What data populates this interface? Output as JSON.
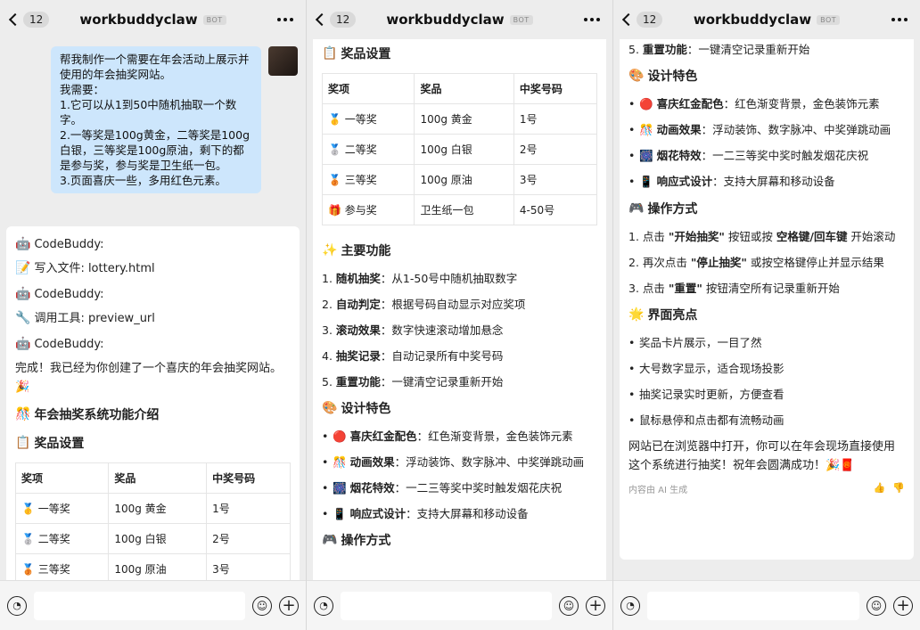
{
  "header": {
    "badge": "12",
    "title": "workbuddyclaw",
    "bot_tag": "BOT"
  },
  "icons": {
    "back": "chevron-left-icon",
    "more": "more-dots-icon",
    "voice": "voice-icon",
    "emoji": "smile-icon",
    "plus": "plus-icon"
  },
  "user_message": [
    "帮我制作一个需要在年会活动上展示并使用的年会抽奖网站。",
    "我需要：",
    "1.它可以从1到50中随机抽取一个数字。",
    "2.一等奖是100g黄金，二等奖是100g白银，三等奖是100g原油，剩下的都是参与奖，参与奖是卫生纸一包。",
    "3.页面喜庆一些，多用红色元素。"
  ],
  "bot_log": [
    {
      "agent": "CodeBuddy:",
      "icon": "🤖",
      "action_icon": "📝",
      "action": "写入文件: lottery.html"
    },
    {
      "agent": "CodeBuddy:",
      "icon": "🤖",
      "action_icon": "🔧",
      "action": "调用工具: preview_url"
    }
  ],
  "final": {
    "agent": "CodeBuddy:",
    "intro": "完成！我已经为你创建了一个喜庆的年会抽奖网站。🎉",
    "heading": "年会抽奖系统功能介绍",
    "heading_icon": "🎊"
  },
  "prize_section": {
    "title": "奖品设置",
    "icon": "📋",
    "headers": [
      "奖项",
      "奖品",
      "中奖号码"
    ],
    "rows": [
      {
        "icon": "🥇",
        "name": "一等奖",
        "prize": "100g 黄金",
        "number": "1号"
      },
      {
        "icon": "🥈",
        "name": "二等奖",
        "prize": "100g 白银",
        "number": "2号"
      },
      {
        "icon": "🥉",
        "name": "三等奖",
        "prize": "100g 原油",
        "number": "3号"
      },
      {
        "icon": "🎁",
        "name": "参与奖",
        "prize": "卫生纸一包",
        "number": "4-50号"
      }
    ]
  },
  "features": {
    "title": "主要功能",
    "icon": "✨",
    "items": [
      {
        "label": "随机抽奖",
        "desc": "：从1-50号中随机抽取数字"
      },
      {
        "label": "自动判定",
        "desc": "：根据号码自动显示对应奖项"
      },
      {
        "label": "滚动效果",
        "desc": "：数字快速滚动增加悬念"
      },
      {
        "label": "抽奖记录",
        "desc": "：自动记录所有中奖号码"
      },
      {
        "label": "重置功能",
        "desc": "：一键清空记录重新开始"
      }
    ]
  },
  "design": {
    "title": "设计特色",
    "icon": "🎨",
    "items": [
      {
        "icon": "🔴",
        "label": "喜庆红金配色",
        "desc": "：红色渐变背景，金色装饰元素"
      },
      {
        "icon": "🎊",
        "label": "动画效果",
        "desc": "：浮动装饰、数字脉冲、中奖弹跳动画"
      },
      {
        "icon": "🎆",
        "label": "烟花特效",
        "desc": "：一二三等奖中奖时触发烟花庆祝"
      },
      {
        "icon": "📱",
        "label": "响应式设计",
        "desc": "：支持大屏幕和移动设备"
      }
    ]
  },
  "operation": {
    "title": "操作方式",
    "icon": "🎮",
    "items": [
      {
        "pre": "点击 ",
        "b1": "\"开始抽奖\"",
        "mid": " 按钮或按 ",
        "b2": "空格键/回车键",
        "post": " 开始滚动"
      },
      {
        "pre": "再次点击 ",
        "b1": "\"停止抽奖\"",
        "mid": " 或按空格键停止并显示结果",
        "b2": "",
        "post": ""
      },
      {
        "pre": "点击 ",
        "b1": "\"重置\"",
        "mid": " 按钮清空所有记录重新开始",
        "b2": "",
        "post": ""
      }
    ]
  },
  "highlights": {
    "title": "界面亮点",
    "icon": "🌟",
    "items": [
      "奖品卡片展示，一目了然",
      "大号数字显示，适合现场投影",
      "抽奖记录实时更新，方便查看",
      "鼠标悬停和点击都有流畅动画"
    ]
  },
  "closing": "网站已在浏览器中打开，你可以在年会现场直接使用这个系统进行抽奖！祝年会圆满成功！🎉🧧",
  "ai_note": "内容由 AI 生成",
  "colors": {
    "user_bubble": "#cde6fc",
    "background": "#ededed"
  }
}
